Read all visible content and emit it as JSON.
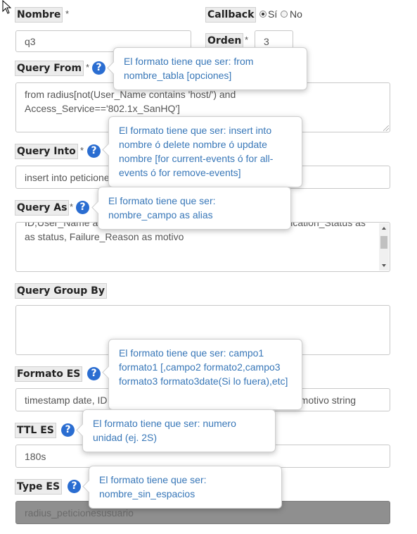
{
  "nombre": {
    "label": "Nombre",
    "required": "*",
    "value": "q3"
  },
  "callback": {
    "label": "Callback",
    "option_si": "Sí",
    "option_no": "No",
    "selected": "Sí"
  },
  "orden": {
    "label": "Orden",
    "required": "*",
    "value": "3"
  },
  "query_from": {
    "label": "Query From",
    "required": "*",
    "value": "from radius[not(User_Name contains 'host/') and Access_Service=='802.1x_SanHQ']",
    "tooltip": "El formato tiene que ser: from nombre_tabla [opciones]"
  },
  "query_into": {
    "label": "Query Into",
    "required": "*",
    "value": "insert into peticione",
    "tooltip": "El formato tiene que ser: insert into nombre ó delete nombre ó update nombre [for current-events ó for all-events ó for remove-events]"
  },
  "query_as": {
    "label": "Query As",
    "required": "*",
    "value_line1_fragment": "ID,User_Name as",
    "value_line1_tail": "Authentication_Status as",
    "value_line2": "as status, Failure_Reason as motivo",
    "tooltip": "El formato tiene que ser: nombre_campo as alias"
  },
  "query_group_by": {
    "label": "Query Group By",
    "value": ""
  },
  "formato_es": {
    "label": "Formato ES",
    "value_start": "timestamp date, ID",
    "value_end": "g,motivo string",
    "tooltip": "El formato tiene que ser: campo1 formato1 [,campo2 formato2,campo3 formato3 formato3date(Si lo fuera),etc]"
  },
  "ttl_es": {
    "label": "TTL ES",
    "value": "180s",
    "tooltip": "El formato tiene que ser: numero unidad (ej. 2S)"
  },
  "type_es": {
    "label": "Type ES",
    "value": "radius_peticionesusuario",
    "tooltip": "El formato tiene que ser: nombre_sin_espacios"
  },
  "help_glyph": "?",
  "icons": {
    "help": "question-circle-icon",
    "cursor": "mouse-pointer-icon"
  },
  "colors": {
    "help": "#2a6dd1",
    "tooltip_text": "#3877b8",
    "disabled_field": "#8f8f8f"
  }
}
